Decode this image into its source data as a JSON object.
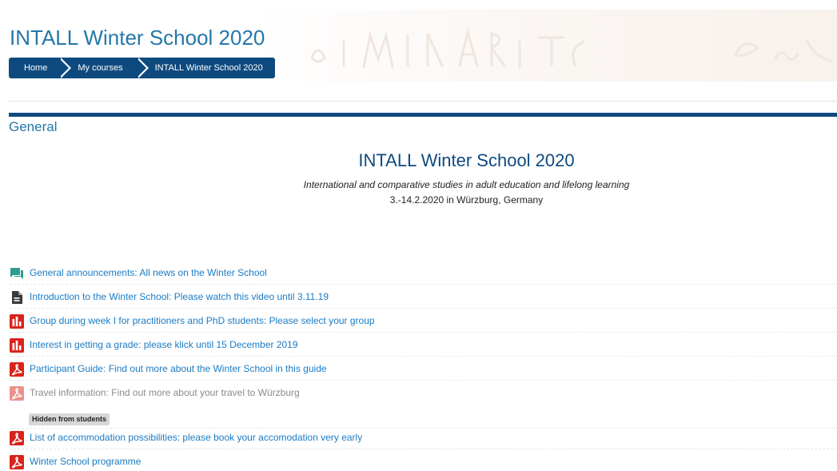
{
  "header": {
    "title": "INTALL Winter School 2020"
  },
  "breadcrumb": {
    "home": "Home",
    "my_courses": "My courses",
    "current": "INTALL Winter School 2020"
  },
  "section": {
    "title": "General"
  },
  "summary": {
    "title": "INTALL Winter School 2020",
    "subtitle": "International and comparative studies in adult education and lifelong learning",
    "dates": "3.-14.2.2020 in Würzburg, Germany"
  },
  "activities": [
    {
      "icon": "forum-icon",
      "label": "General announcements: All news on the Winter School",
      "dimmed": false
    },
    {
      "icon": "page-icon",
      "label": "Introduction to the Winter School: Please watch this video until 3.11.19",
      "dimmed": false
    },
    {
      "icon": "choice-icon",
      "label": "Group during week I for practitioners and PhD students: Please select your group",
      "dimmed": false
    },
    {
      "icon": "choice-icon",
      "label": "Interest in getting a grade: please klick until 15 December 2019",
      "dimmed": false
    },
    {
      "icon": "pdf-icon",
      "label": "Participant Guide: Find out more about the Winter School in this guide",
      "dimmed": false
    },
    {
      "icon": "pdf-icon",
      "label": "Travel information: Find out more about your travel to Würzburg",
      "dimmed": true
    },
    {
      "icon": "pdf-icon",
      "label": "List of accommodation possibilities: please book your accomodation very early",
      "dimmed": false
    },
    {
      "icon": "pdf-icon",
      "label": "Winter School programme",
      "dimmed": false
    }
  ],
  "badges": {
    "hidden_from_students": "Hidden from students"
  },
  "colors": {
    "brand_blue": "#0f4a7f",
    "title_blue": "#2478a8",
    "link_blue": "#1a7bc4",
    "forum_green": "#2e9c8f",
    "choice_red": "#d9241b",
    "pdf_red": "#d9241b"
  }
}
